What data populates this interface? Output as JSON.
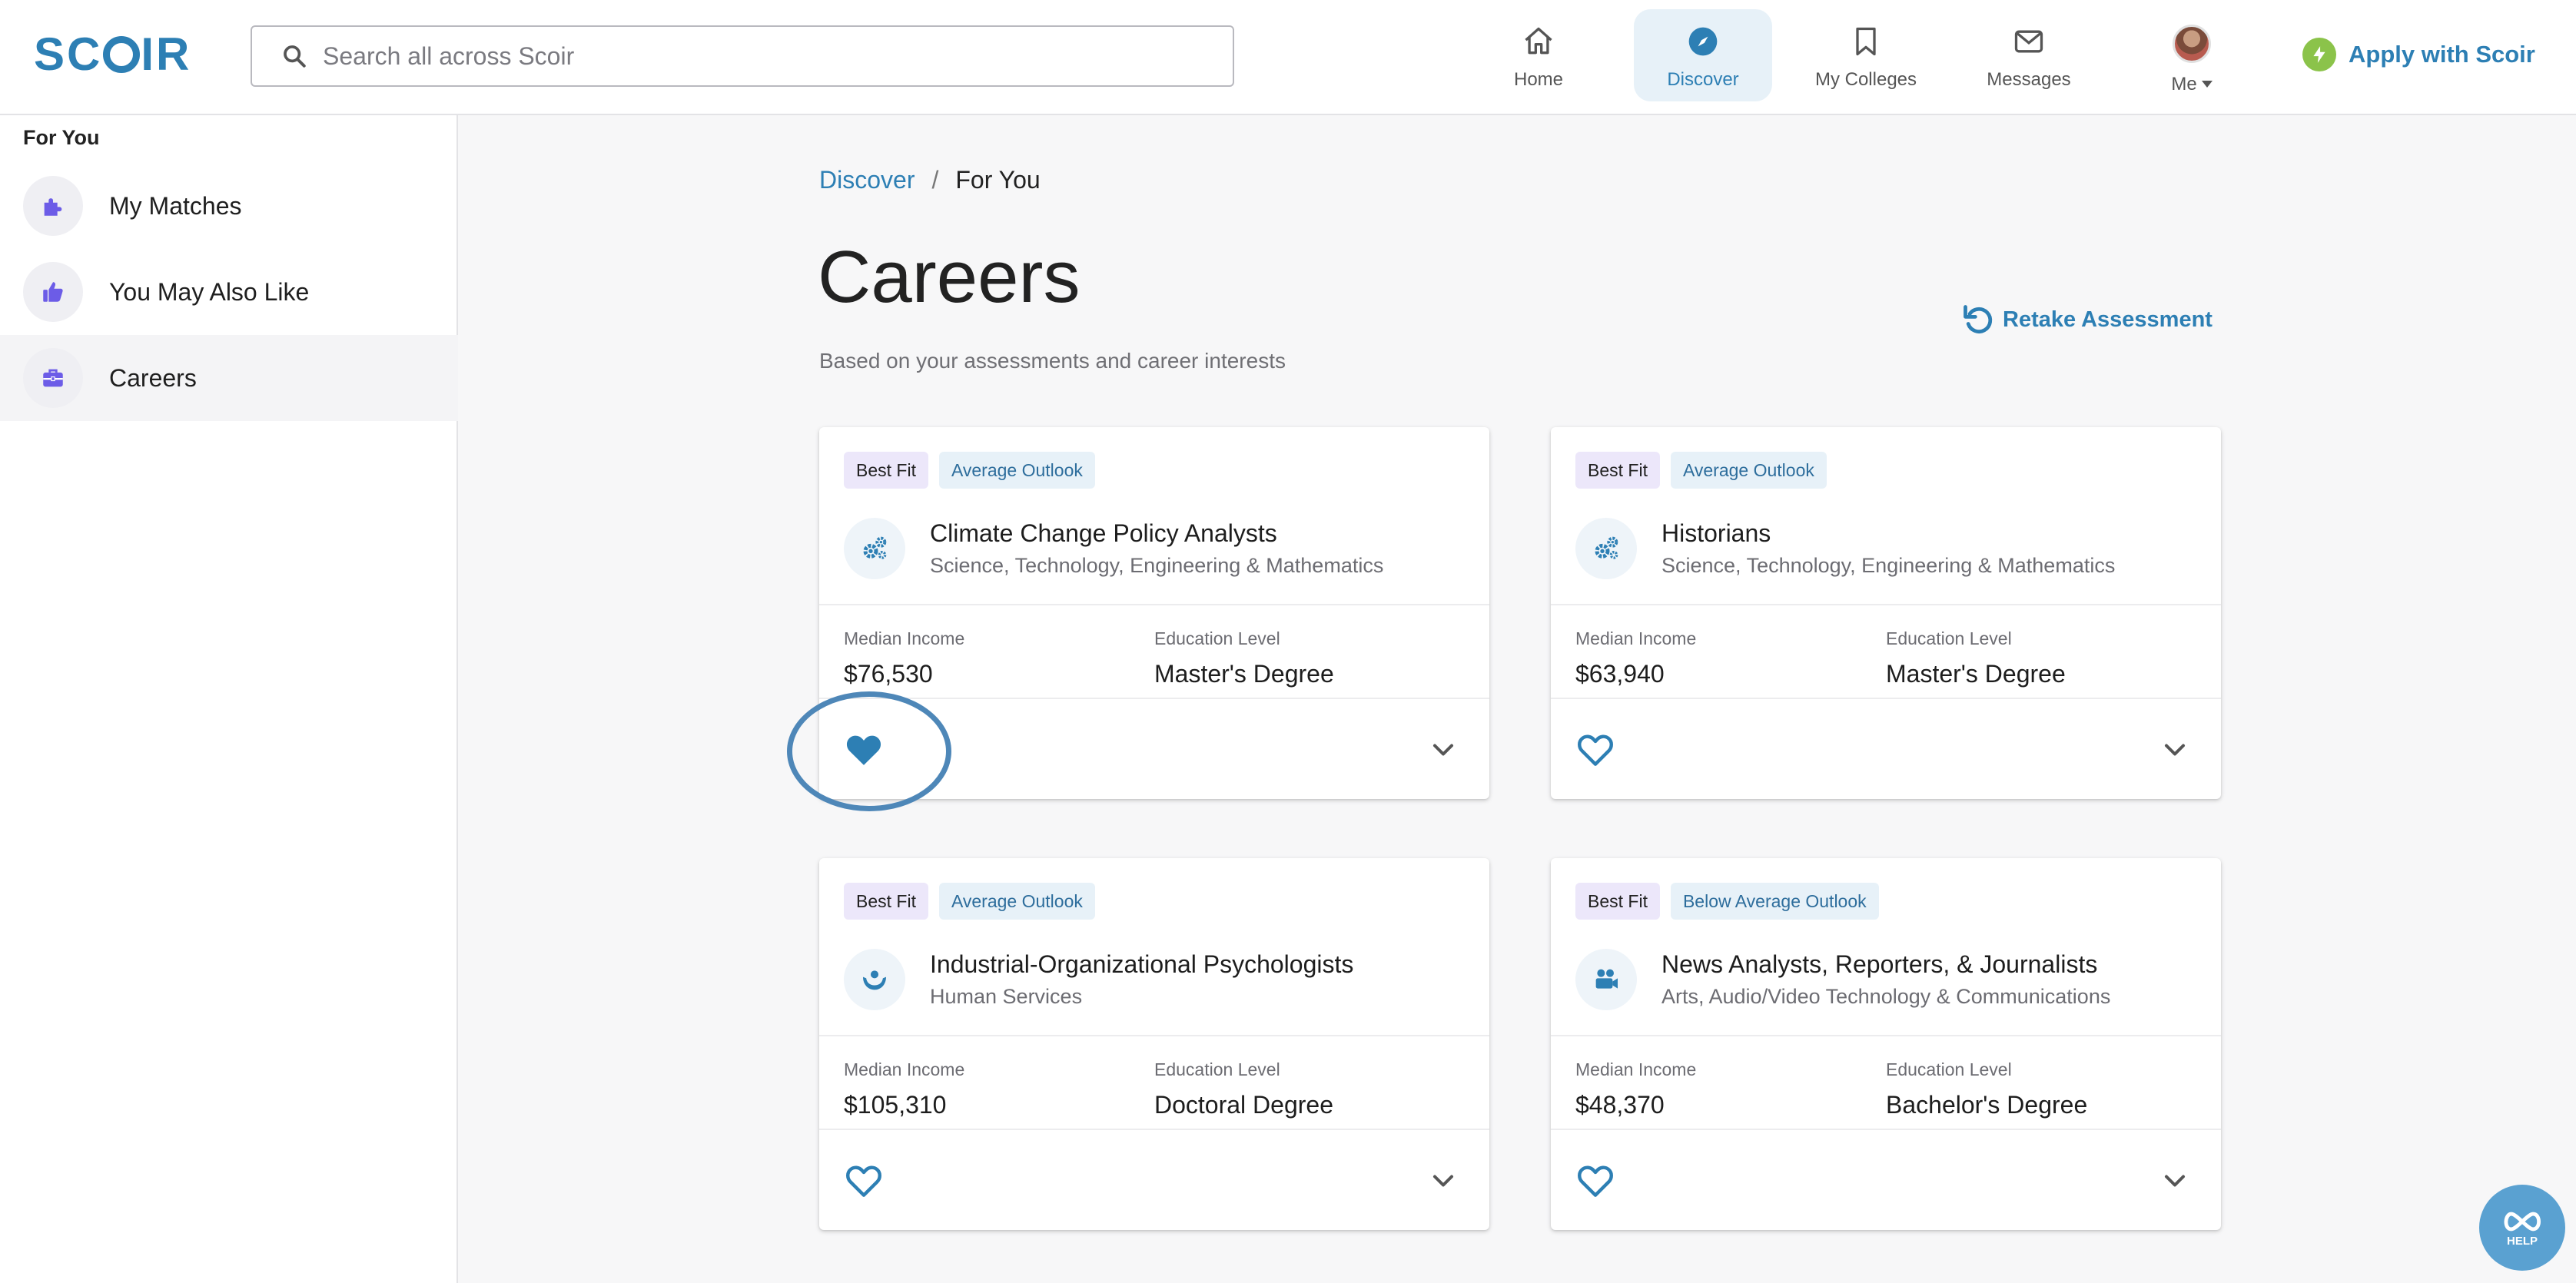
{
  "header": {
    "logo": "SCOIR",
    "search_placeholder": "Search all across Scoir",
    "nav": [
      {
        "label": "Home",
        "icon": "home-icon"
      },
      {
        "label": "Discover",
        "icon": "compass-icon",
        "active": true
      },
      {
        "label": "My Colleges",
        "icon": "bookmark-icon"
      },
      {
        "label": "Messages",
        "icon": "mail-icon"
      },
      {
        "label": "Me",
        "icon": "avatar"
      }
    ],
    "apply_label": "Apply with Scoir"
  },
  "sidebar": {
    "title": "For You",
    "items": [
      {
        "label": "My Matches",
        "icon": "puzzle-icon"
      },
      {
        "label": "You May Also Like",
        "icon": "thumbs-up-icon"
      },
      {
        "label": "Careers",
        "icon": "briefcase-icon",
        "active": true
      }
    ]
  },
  "main": {
    "breadcrumb": {
      "parent": "Discover",
      "separator": "/",
      "current": "For You"
    },
    "title": "Careers",
    "subtitle": "Based on your assessments and career interests",
    "retake_label": "Retake Assessment",
    "cards": [
      {
        "fit": "Best Fit",
        "outlook": "Average Outlook",
        "name": "Climate Change Policy Analysts",
        "cluster": "Science, Technology, Engineering & Mathematics",
        "icon": "gears-icon",
        "income_label": "Median Income",
        "income": "$76,530",
        "education_label": "Education Level",
        "education": "Master's Degree",
        "favorited": true
      },
      {
        "fit": "Best Fit",
        "outlook": "Average Outlook",
        "name": "Historians",
        "cluster": "Science, Technology, Engineering & Mathematics",
        "icon": "gears-icon",
        "income_label": "Median Income",
        "income": "$63,940",
        "education_label": "Education Level",
        "education": "Master's Degree",
        "favorited": false
      },
      {
        "fit": "Best Fit",
        "outlook": "Average Outlook",
        "name": "Industrial-Organizational Psychologists",
        "cluster": "Human Services",
        "icon": "helping-hands-icon",
        "income_label": "Median Income",
        "income": "$105,310",
        "education_label": "Education Level",
        "education": "Doctoral Degree",
        "favorited": false
      },
      {
        "fit": "Best Fit",
        "outlook": "Below Average Outlook",
        "name": "News Analysts, Reporters, & Journalists",
        "cluster": "Arts, Audio/Video Technology & Communications",
        "icon": "video-camera-icon",
        "income_label": "Median Income",
        "income": "$48,370",
        "education_label": "Education Level",
        "education": "Bachelor's Degree",
        "favorited": false
      }
    ]
  },
  "help": {
    "label": "HELP"
  },
  "colors": {
    "accent": "#2d7fb4",
    "fit_tag_bg": "#ece7fa",
    "outlook_tag_bg": "#e7f1f8",
    "sidebar_icon": "#6c5ce7"
  }
}
